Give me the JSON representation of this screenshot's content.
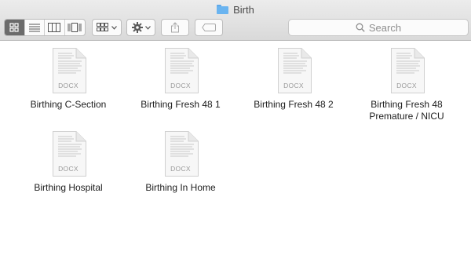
{
  "window": {
    "title": "Birth"
  },
  "toolbar": {
    "view_modes": [
      "icon-view",
      "list-view",
      "column-view",
      "cover-flow-view"
    ],
    "active_view": "icon-view",
    "search_placeholder": "Search"
  },
  "files": [
    {
      "name": "Birthing C-Section",
      "ext": "DOCX"
    },
    {
      "name": "Birthing Fresh 48 1",
      "ext": "DOCX"
    },
    {
      "name": "Birthing Fresh 48 2",
      "ext": "DOCX"
    },
    {
      "name": "Birthing Fresh 48 Premature / NICU",
      "ext": "DOCX"
    },
    {
      "name": "Birthing Hospital",
      "ext": "DOCX"
    },
    {
      "name": "Birthing In Home",
      "ext": "DOCX"
    }
  ],
  "colors": {
    "folder": "#6ab4f0",
    "toolbar_bg": "#e3e3e3",
    "active_segment": "#6b6b6b"
  }
}
